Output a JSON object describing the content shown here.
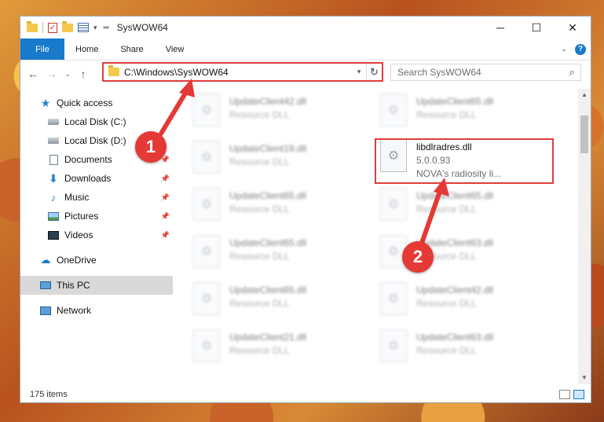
{
  "window": {
    "title": "SysWOW64",
    "minimize_glyph": "─",
    "maximize_glyph": "☐",
    "close_glyph": "✕"
  },
  "ribbon": {
    "file": "File",
    "tabs": [
      "Home",
      "Share",
      "View"
    ],
    "help": "?"
  },
  "address": {
    "path": "C:\\Windows\\SysWOW64",
    "refresh_glyph": "↻",
    "back_glyph": "←",
    "forward_glyph": "→",
    "recent_glyph": "⌄",
    "up_glyph": "↑"
  },
  "search": {
    "placeholder": "Search SysWOW64"
  },
  "nav": {
    "quick_access": "Quick access",
    "items": [
      {
        "label": "Local Disk (C:)"
      },
      {
        "label": "Local Disk (D:)"
      },
      {
        "label": "Documents"
      },
      {
        "label": "Downloads"
      },
      {
        "label": "Music"
      },
      {
        "label": "Pictures"
      },
      {
        "label": "Videos"
      }
    ],
    "onedrive": "OneDrive",
    "this_pc": "This PC",
    "network": "Network"
  },
  "files": {
    "left_column": [
      {
        "name": "UpdateClient42.dll",
        "type": "Resource DLL"
      },
      {
        "name": "UpdateClient19.dll",
        "type": "Resource DLL"
      },
      {
        "name": "UpdateClient65.dll",
        "type": "Resource DLL"
      },
      {
        "name": "UpdateClient65.dll",
        "type": "Resource DLL"
      },
      {
        "name": "UpdateClient65.dll",
        "type": "Resource DLL"
      },
      {
        "name": "UpdateClient21.dll",
        "type": "Resource DLL"
      }
    ],
    "right_column": [
      {
        "name": "UpdateClient65.dll",
        "type": "Resource DLL"
      },
      {
        "name": "UpdateClient65.dll",
        "type": "Resource DLL"
      },
      {
        "name": "UpdateClient63.dll",
        "type": "Resource DLL"
      },
      {
        "name": "UpdateClient42.dll",
        "type": "Resource DLL"
      },
      {
        "name": "UpdateClient63.dll",
        "type": "Resource DLL"
      }
    ],
    "highlighted": {
      "name": "libdlradres.dll",
      "version": "5.0.0.93",
      "description": "NOVA's radiosity li..."
    }
  },
  "status": {
    "count": "175 items"
  },
  "annotations": {
    "badge1": "1",
    "badge2": "2",
    "color": "#e53935"
  }
}
